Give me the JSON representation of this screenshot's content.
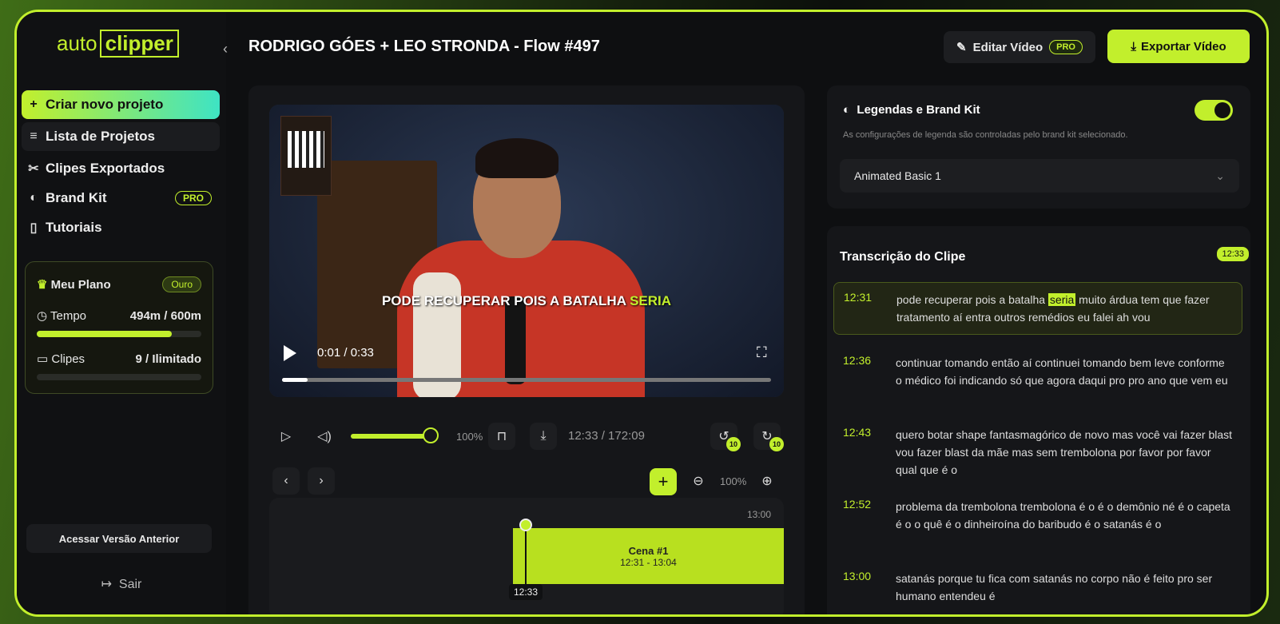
{
  "app": {
    "logo_left": "auto",
    "logo_right": "clipper"
  },
  "sidebar": {
    "items": [
      {
        "label": "Criar novo projeto",
        "icon": "plus-icon"
      },
      {
        "label": "Lista de Projetos",
        "icon": "list-icon"
      },
      {
        "label": "Clipes Exportados",
        "icon": "scissors-icon"
      },
      {
        "label": "Brand Kit",
        "icon": "palette-icon",
        "badge": "PRO"
      },
      {
        "label": "Tutoriais",
        "icon": "book-icon"
      }
    ],
    "plan": {
      "title": "Meu Plano",
      "tier": "Ouro",
      "time_label": "Tempo",
      "time_value": "494m / 600m",
      "time_progress": 0.82,
      "clips_label": "Clipes",
      "clips_value": "9 / Ilimitado"
    },
    "old_version": "Acessar Versão Anterior",
    "logout": "Sair"
  },
  "header": {
    "title": "RODRIGO GÓES + LEO STRONDA - Flow #497",
    "edit_label": "Editar Vídeo",
    "edit_badge": "PRO",
    "export_label": "Exportar Vídeo"
  },
  "video": {
    "caption_main": "PODE RECUPERAR POIS A BATALHA",
    "caption_highlight": "SERIA",
    "time": "0:01 / 0:33",
    "progress": 0.05
  },
  "controls": {
    "volume": "100%",
    "position": "12:33 / 172:09",
    "rewind_badge": "10",
    "forward_badge": "10",
    "zoom": "100%"
  },
  "timeline": {
    "end_label": "13:00",
    "scene_name": "Cena #1",
    "scene_range": "12:31 - 13:04",
    "playhead_label": "12:33"
  },
  "brand": {
    "title": "Legendas e Brand Kit",
    "subtitle": "As configurações de legenda são controladas pelo brand kit selecionado.",
    "enabled": true,
    "selected": "Animated Basic 1"
  },
  "transcript": {
    "title": "Transcrição do Clipe",
    "badge": "12:33",
    "segments": [
      {
        "ts": "12:31",
        "pre": "pode recuperar pois a batalha ",
        "hl": "seria",
        "post": " muito árdua tem que fazer tratamento aí entra outros remédios eu falei ah vou"
      },
      {
        "ts": "12:36",
        "text": "continuar tomando então aí continuei tomando bem leve conforme o médico foi indicando só que agora daqui pro pro ano que vem eu"
      },
      {
        "ts": "12:43",
        "text": "quero botar shape fantasmagórico de novo mas você vai fazer blast vou fazer blast da mãe mas sem trembolona por favor por favor qual que é o"
      },
      {
        "ts": "12:52",
        "text": "problema da trembolona trembolona é o é o demônio né é o capeta é o o quê é o dinheiroína do baribudo é o satanás é o"
      },
      {
        "ts": "13:00",
        "text": "satanás porque tu fica com satanás no corpo não é feito pro ser humano entendeu é"
      }
    ]
  },
  "colors": {
    "accent": "#c2ef2c",
    "bg": "#0e0f11",
    "panel": "#151619"
  }
}
